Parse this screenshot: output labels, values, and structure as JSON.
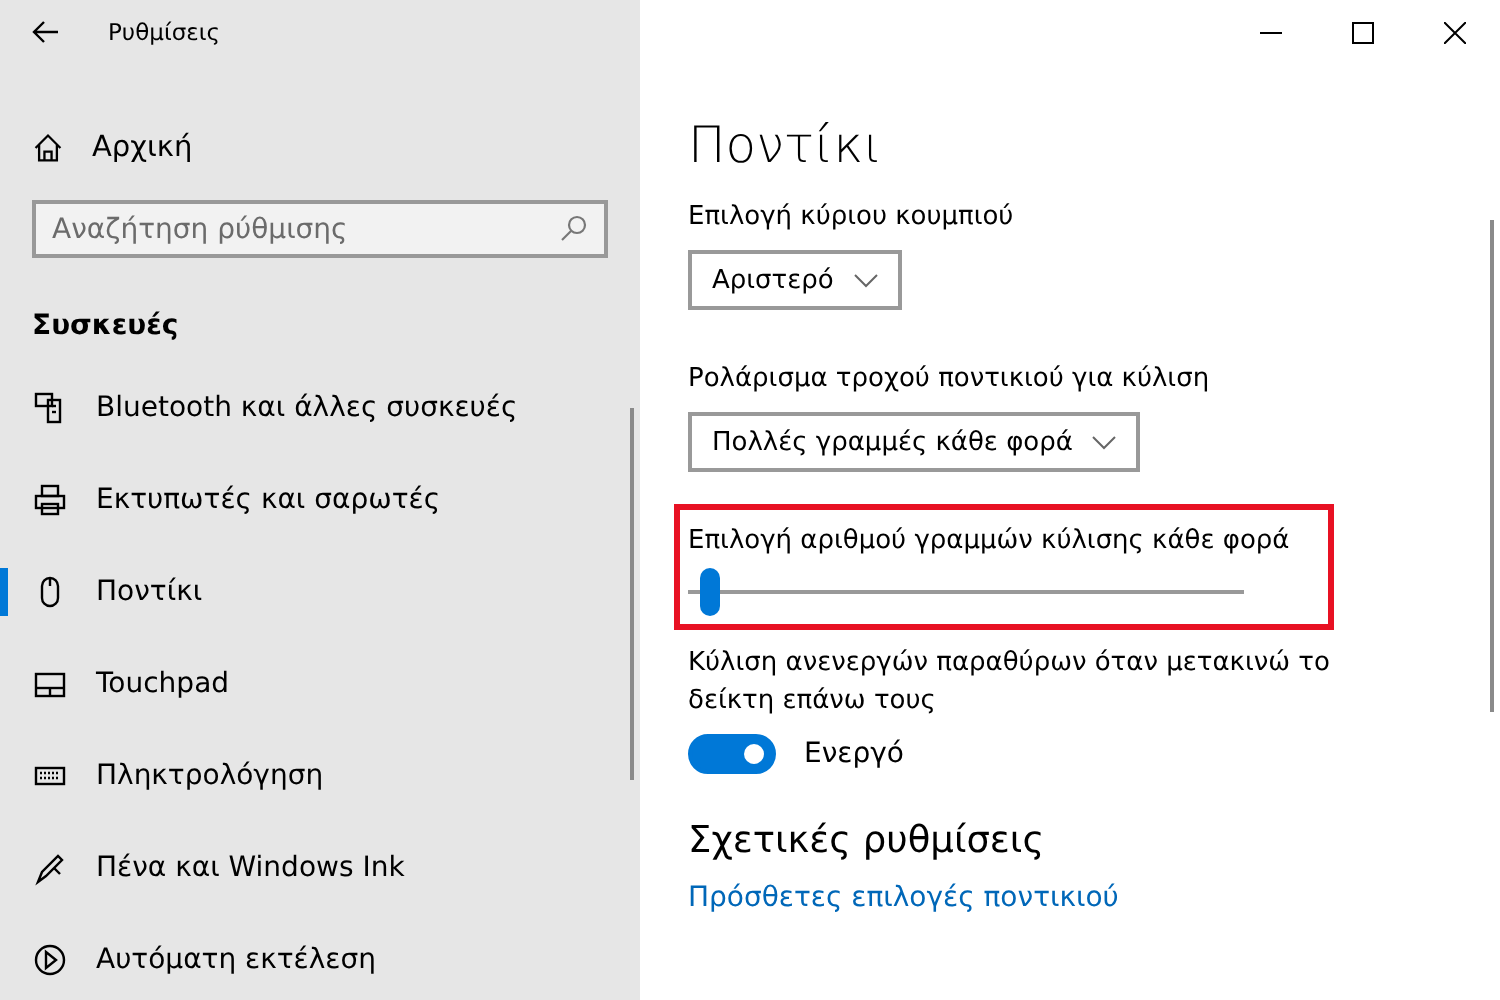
{
  "window": {
    "title": "Ρυθμίσεις"
  },
  "sidebar": {
    "home": "Αρχική",
    "search": {
      "placeholder": "Αναζήτηση ρύθμισης"
    },
    "section": "Συσκευές",
    "items": [
      {
        "kind": "devices",
        "label": "Bluetooth και άλλες συσκευές",
        "selected": false
      },
      {
        "kind": "printer",
        "label": "Εκτυπωτές και σαρωτές",
        "selected": false
      },
      {
        "kind": "mouse",
        "label": "Ποντίκι",
        "selected": true
      },
      {
        "kind": "touchpad",
        "label": "Touchpad",
        "selected": false
      },
      {
        "kind": "keyboard",
        "label": "Πληκτρολόγηση",
        "selected": false
      },
      {
        "kind": "pen",
        "label": "Πένα και Windows Ink",
        "selected": false
      },
      {
        "kind": "autoplay",
        "label": "Αυτόματη εκτέλεση",
        "selected": false
      }
    ]
  },
  "page": {
    "title": "Ποντίκι",
    "settings": [
      {
        "kind": "dropdown",
        "label": "Επιλογή κύριου κουμπιού",
        "value": "Αριστερό"
      },
      {
        "kind": "dropdown",
        "label": "Ρολάρισμα τροχού ποντικιού για κύλιση",
        "value": "Πολλές γραμμές κάθε φορά"
      },
      {
        "kind": "slider",
        "label": "Επιλογή αριθμού γραμμών κύλισης κάθε φορά",
        "level": 0.02,
        "highlighted": true
      },
      {
        "kind": "toggle",
        "label": "Κύλιση ανενεργών παραθύρων όταν μετακινώ το δείκτη επάνω τους",
        "on": true,
        "state": "Ενεργό"
      }
    ],
    "related": {
      "title": "Σχετικές ρυθμίσεις",
      "links": [
        "Πρόσθετες επιλογές ποντικιού"
      ]
    }
  }
}
